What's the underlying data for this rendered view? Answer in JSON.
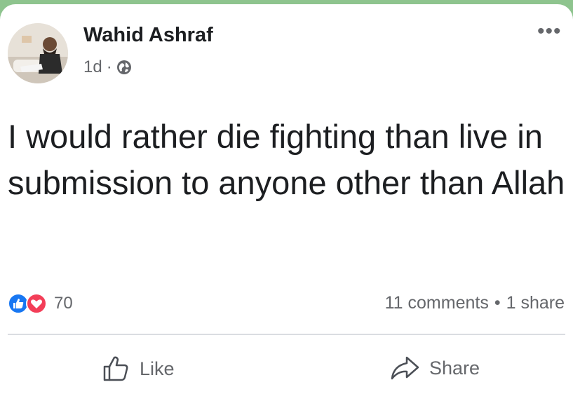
{
  "post": {
    "author": "Wahid Ashraf",
    "timestamp": "1d",
    "separator": "·",
    "audience_icon": "globe-icon",
    "menu_icon": "more-options-icon",
    "menu_glyph": "•••",
    "text": "I would rather die fighting than live in submission to anyone other than Allah"
  },
  "engagement": {
    "reaction_icons": [
      "like-reaction-icon",
      "love-reaction-icon"
    ],
    "reaction_count": "70",
    "comments": "11 comments",
    "stat_separator": "•",
    "shares": "1 share"
  },
  "actions": {
    "like_label": "Like",
    "share_label": "Share"
  },
  "colors": {
    "background": "#8ec48e",
    "like_blue": "#1877f2",
    "love_red": "#f33e58",
    "muted_text": "#65676b",
    "primary_text": "#1c1e21"
  }
}
